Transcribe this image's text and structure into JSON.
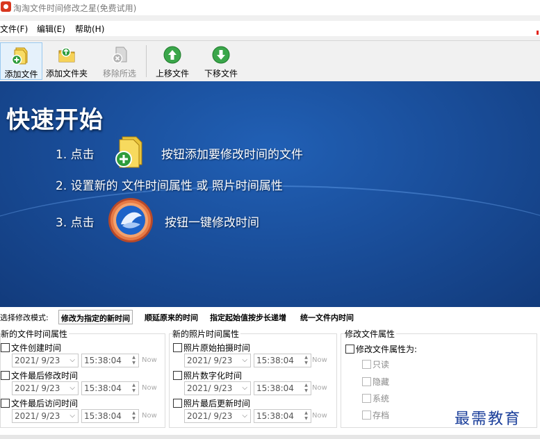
{
  "window": {
    "title": "淘淘文件时间修改之星(免费试用)"
  },
  "menu": {
    "items": [
      "文件(F)",
      "编辑(E)",
      "帮助(H)"
    ]
  },
  "toolbar": {
    "add_file": "添加文件",
    "add_folder": "添加文件夹",
    "remove_selected": "移除所选",
    "move_up": "上移文件",
    "move_down": "下移文件"
  },
  "quickstart": {
    "title": "快速开始",
    "step1_prefix": "1.  点击",
    "step1_suffix": "按钮添加要修改时间的文件",
    "step2": "2.  设置新的 文件时间属性 或 照片时间属性",
    "step3_prefix": "3.  点击",
    "step3_suffix": "按钮一键修改时间"
  },
  "mode": {
    "label": "选择修改模式:",
    "tabs": [
      "修改为指定的新时间",
      "顺延原来的时间",
      "指定起始值按步长递增",
      "统一文件内时间"
    ],
    "selected": "修改为指定的新时间"
  },
  "file_time": {
    "title": "新的文件时间属性",
    "rows": [
      {
        "label": "文件创建时间",
        "date": "2021/  9/23",
        "time": "15:38:04",
        "now": "Now"
      },
      {
        "label": "文件最后修改时间",
        "date": "2021/  9/23",
        "time": "15:38:04",
        "now": "Now"
      },
      {
        "label": "文件最后访问时间",
        "date": "2021/  9/23",
        "time": "15:38:04",
        "now": "Now"
      }
    ]
  },
  "photo_time": {
    "title": "新的照片时间属性",
    "rows": [
      {
        "label": "照片原始拍摄时间",
        "date": "2021/  9/23",
        "time": "15:38:04",
        "now": "Now"
      },
      {
        "label": "照片数字化时间",
        "date": "2021/  9/23",
        "time": "15:38:04",
        "now": "Now"
      },
      {
        "label": "照片最后更新时间",
        "date": "2021/  9/23",
        "time": "15:38:04",
        "now": "Now"
      }
    ]
  },
  "file_attr": {
    "title": "修改文件属性",
    "main_label": "修改文件属性为:",
    "options": [
      "只读",
      "隐藏",
      "系统",
      "存档"
    ]
  },
  "watermark": "最需教育",
  "colors": {
    "banner": "#1a4f9c",
    "watermark": "#1a3e9a",
    "accent_red": "#e2231a"
  }
}
